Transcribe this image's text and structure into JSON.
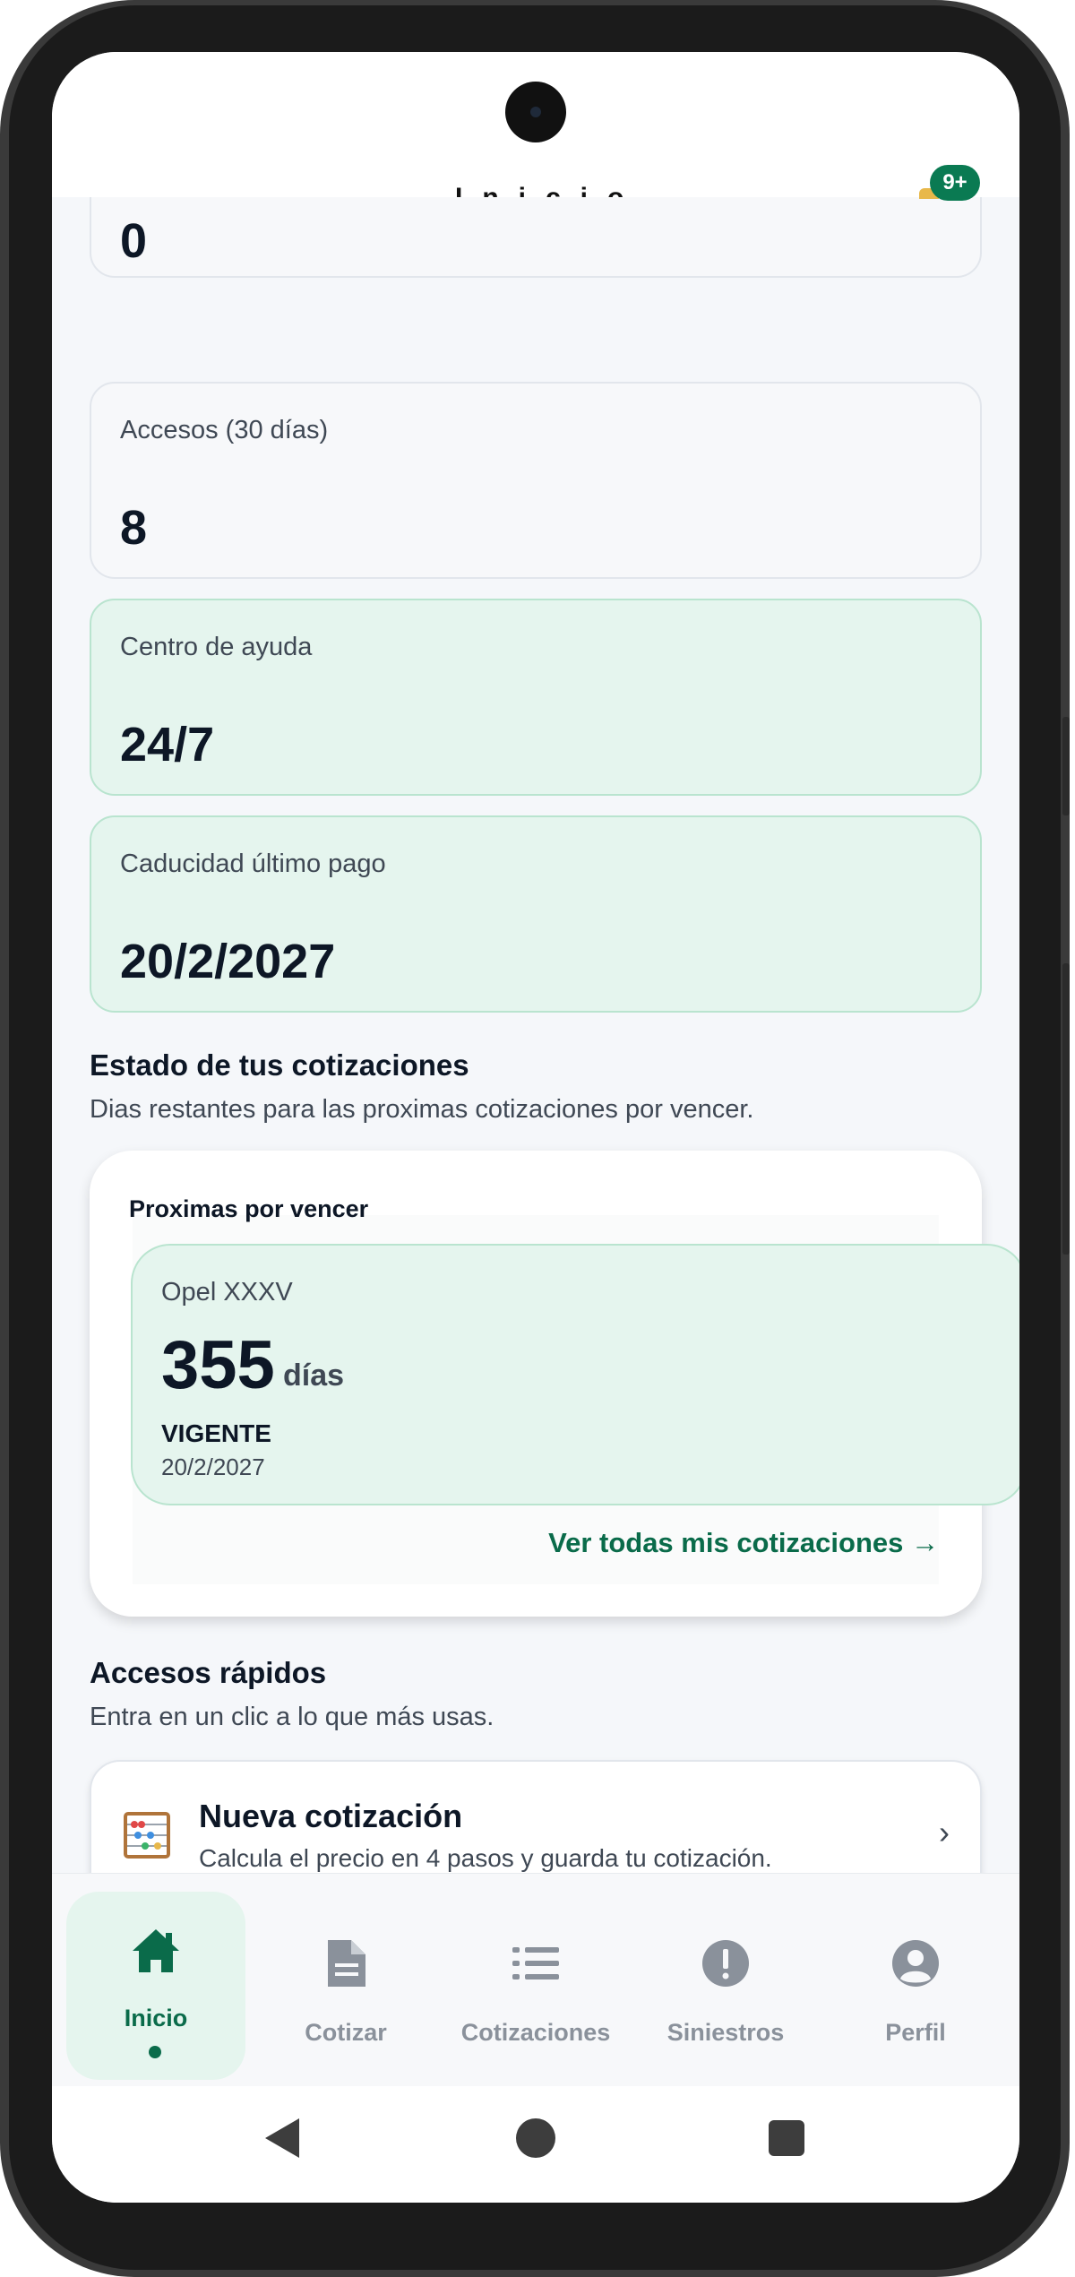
{
  "header": {
    "title_peek": "Inicio",
    "notification_count": "9+"
  },
  "stats": [
    {
      "label": "",
      "value": "0"
    },
    {
      "label": "Accesos (30 días)",
      "value": "8"
    },
    {
      "label": "Centro de ayuda",
      "value": "24/7"
    },
    {
      "label": "Caducidad último pago",
      "value": "20/2/2027"
    }
  ],
  "quotes_section": {
    "title": "Estado de tus cotizaciones",
    "subtitle": "Dias restantes para las proximas cotizaciones por vencer.",
    "card_heading": "Proximas por vencer",
    "item": {
      "name": "Opel XXXV",
      "days": "355",
      "days_unit": "días",
      "status": "VIGENTE",
      "date": "20/2/2027"
    },
    "view_all": "Ver todas mis cotizaciones →"
  },
  "quick_access": {
    "title": "Accesos rápidos",
    "subtitle": "Entra en un clic a lo que más usas.",
    "items": [
      {
        "title": "Nueva cotización",
        "subtitle": "Calcula el precio en 4 pasos y guarda tu cotización.",
        "chevron": "›",
        "icon": "abacus-icon"
      }
    ]
  },
  "bottom_nav": {
    "items": [
      {
        "label": "Inicio",
        "icon": "home-icon",
        "active": true
      },
      {
        "label": "Cotizar",
        "icon": "document-icon",
        "active": false
      },
      {
        "label": "Cotizaciones",
        "icon": "list-icon",
        "active": false
      },
      {
        "label": "Siniestros",
        "icon": "alert-icon",
        "active": false
      },
      {
        "label": "Perfil",
        "icon": "profile-icon",
        "active": false
      }
    ]
  },
  "colors": {
    "brand": "#0a6b4a",
    "card_green": "#e5f5ee",
    "inactive_nav": "#8a919b"
  }
}
